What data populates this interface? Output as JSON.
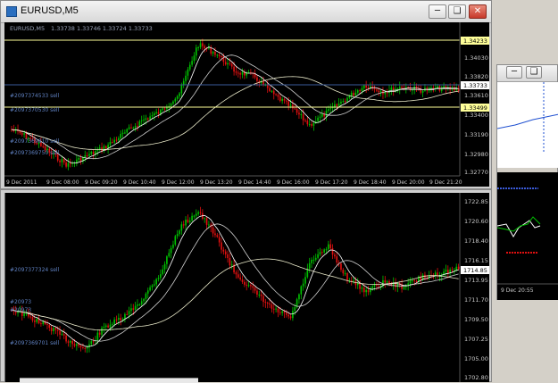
{
  "window": {
    "title": "EURUSD,M5"
  },
  "top_chart": {
    "symbol_label": "EURUSD,M5",
    "ohlc": "1.33738 1.33746 1.33724 1.33733",
    "price_ticks": [
      "1.34030",
      "1.33820",
      "1.33610",
      "1.33400",
      "1.33190",
      "1.32980",
      "1.32770"
    ],
    "hline_labels": [
      "1.34233",
      "1.33733",
      "1.33499"
    ],
    "time_labels": [
      "9 Dec 2011",
      "9 Dec 08:00",
      "9 Dec 09:20",
      "9 Dec 10:40",
      "9 Dec 12:00",
      "9 Dec 13:20",
      "9 Dec 14:40",
      "9 Dec 16:00",
      "9 Dec 17:20",
      "9 Dec 18:40",
      "9 Dec 20:00",
      "9 Dec 21:20"
    ],
    "orders": [
      "#2097374533 sell",
      "#2097370530 sell",
      "#2097369810 sell",
      "#2097369750 sell"
    ]
  },
  "bottom_chart": {
    "price_ticks": [
      "1722.85",
      "1720.60",
      "1718.40",
      "1716.15",
      "1713.95",
      "1711.70",
      "1709.50",
      "1707.25",
      "1705.00",
      "1702.80"
    ],
    "current_price": "1714.85",
    "orders": [
      "#2097377324 sell",
      "#2097369701 sell"
    ]
  },
  "side_chart": {
    "time_label": "9 Dec 20:55"
  },
  "colors": {
    "bull": "#00c000",
    "bear": "#e01010",
    "bg": "#000000",
    "ask_line": "#1e4fd0",
    "level_line": "#ffff99"
  },
  "icons": {
    "minimize": "minimize-icon",
    "restore": "restore-icon",
    "close": "close-icon"
  }
}
